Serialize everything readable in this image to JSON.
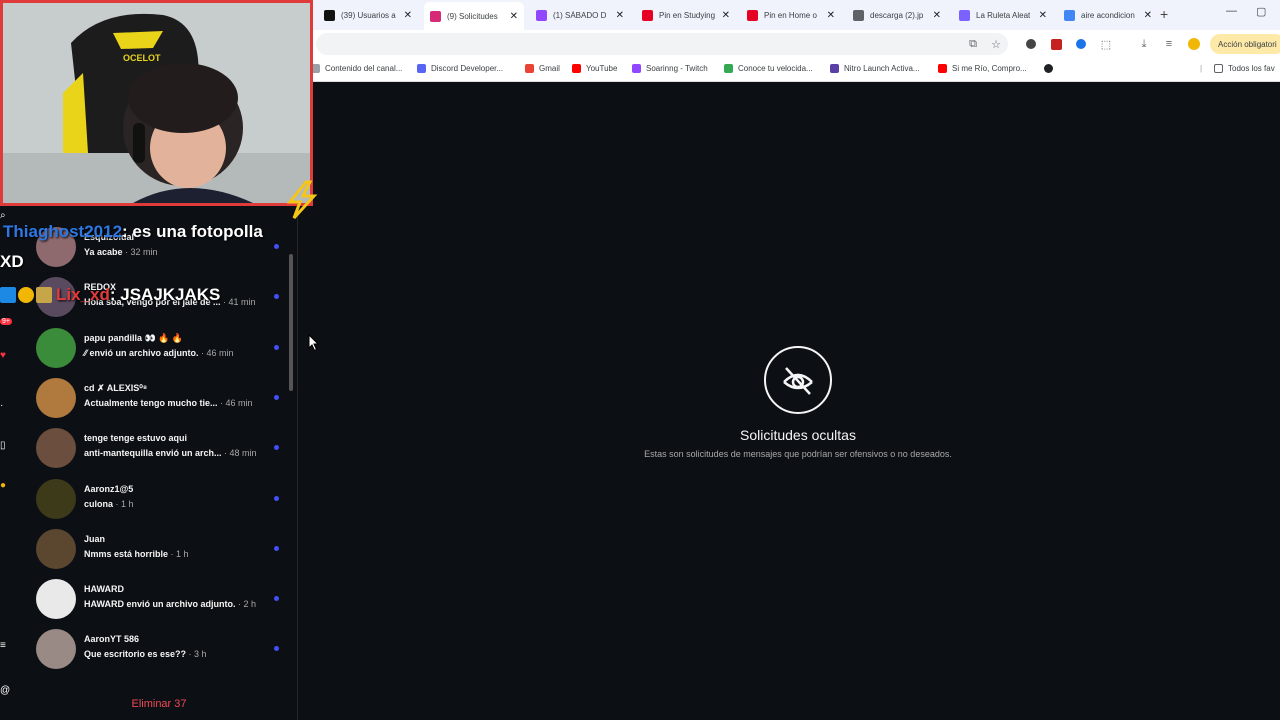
{
  "tabs": [
    {
      "label": "(39) Usuarios a",
      "icon": "x-logo-icon",
      "color": "#111111",
      "active": false
    },
    {
      "label": "(9) Solicitudes",
      "icon": "instagram-icon",
      "color": "#d62976",
      "active": true
    },
    {
      "label": "(1) SÁBADO D",
      "icon": "twitch-icon",
      "color": "#9146ff",
      "active": false
    },
    {
      "label": "Pin en Studying",
      "icon": "pinterest-icon",
      "color": "#e60023",
      "active": false
    },
    {
      "label": "Pin en Home o",
      "icon": "pinterest-icon",
      "color": "#e60023",
      "active": false
    },
    {
      "label": "descarga (2).jp",
      "icon": "globe-icon",
      "color": "#5f6368",
      "active": false
    },
    {
      "label": "La Ruleta Aleat",
      "icon": "roulette-icon",
      "color": "#7b61ff",
      "active": false
    },
    {
      "label": "aire acondicion",
      "icon": "google-icon",
      "color": "#4285f4",
      "active": false
    }
  ],
  "toolbar": {
    "required_action": "Acción obligatori"
  },
  "bookmarks": [
    {
      "label": "Contenido del canal...",
      "icon": "link-icon",
      "color": "#9aa0a6"
    },
    {
      "label": "Discord Developer...",
      "icon": "discord-icon",
      "color": "#5865f2"
    },
    {
      "label": "Gmail",
      "icon": "gmail-icon",
      "color": "#ea4335"
    },
    {
      "label": "YouTube",
      "icon": "youtube-icon",
      "color": "#ff0000"
    },
    {
      "label": "Soarinng - Twitch",
      "icon": "twitch-icon",
      "color": "#9146ff"
    },
    {
      "label": "Conoce tu velocida...",
      "icon": "speed-icon",
      "color": "#34a853"
    },
    {
      "label": "Nitro Launch Activa...",
      "icon": "nitro-icon",
      "color": "#5b3fa5"
    },
    {
      "label": "Si me Río, Compro...",
      "icon": "youtube-icon",
      "color": "#ff0000"
    }
  ],
  "bookmarks_folder": "Todos los fav",
  "requests": [
    {
      "name": "Esquizoidal",
      "message": "Ya acabe",
      "time": "32 min",
      "avatar_color": "#8e6a6f"
    },
    {
      "name": "REDOX",
      "message": "Hola soa, vengo por el jale de ...",
      "time": "41 min",
      "avatar_color": "#5a4a5f"
    },
    {
      "name": "papu pandilla 👀 🔥 🔥",
      "message": "⁄⁄ envió un archivo adjunto.",
      "time": "46 min",
      "avatar_color": "#3b8c3a"
    },
    {
      "name": "cd ✗ ALEXIS⁰⁸",
      "message": "Actualmente tengo mucho tie...",
      "time": "46 min",
      "avatar_color": "#b07a3e"
    },
    {
      "name": "tenge tenge estuvo aqui",
      "message": "anti-mantequilla envió un arch...",
      "time": "48 min",
      "avatar_color": "#6b4e3d"
    },
    {
      "name": "Aaronz1@5",
      "message": "culona",
      "time": "1 h",
      "avatar_color": "#3d3a1a"
    },
    {
      "name": "Juan",
      "message": "Nmms está horrible",
      "time": "1 h",
      "avatar_color": "#5b4630"
    },
    {
      "name": "HAWARD",
      "message": "HAWARD envió un archivo adjunto.",
      "time": "2 h",
      "avatar_color": "#e9e9e9"
    },
    {
      "name": "AaronYT 586",
      "message": "Que escritorio es ese??",
      "time": "3 h",
      "avatar_color": "#9a8a86"
    }
  ],
  "delete_label": "Eliminar 37",
  "hidden": {
    "title": "Solicitudes ocultas",
    "description": "Estas son solicitudes de mensajes que podrían ser ofensivos o no deseados."
  },
  "stream_chat": [
    {
      "user": "Thiaghost2012",
      "message": ": es una fotopolla"
    },
    {
      "user": "XD",
      "message": ""
    },
    {
      "user": "Lix_xd",
      "message": ": JSAJKJAKS"
    }
  ],
  "webcam_chair_brand": "OCELOT"
}
